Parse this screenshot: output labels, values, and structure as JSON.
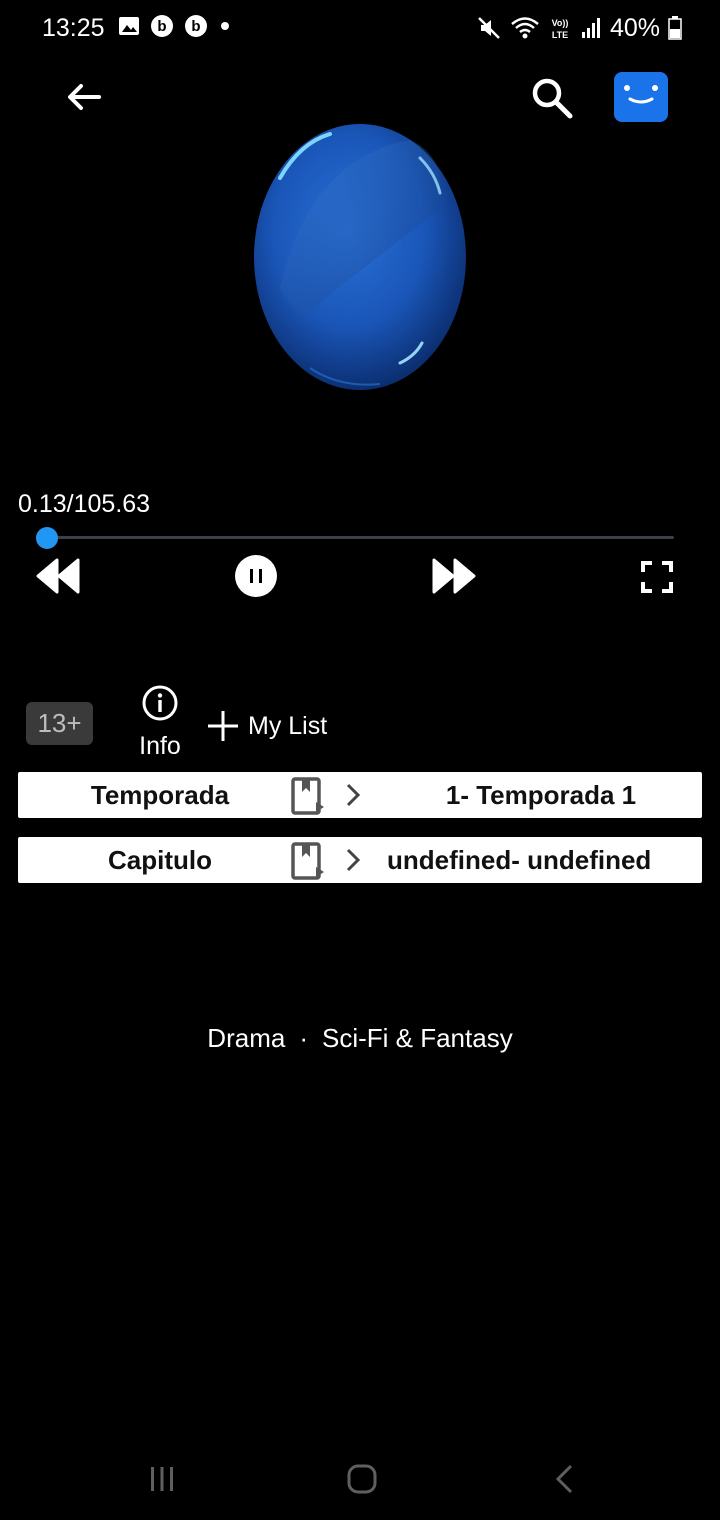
{
  "status_bar": {
    "time": "13:25",
    "battery": "40%",
    "icons": [
      "gallery-icon",
      "b-app-icon",
      "b-app-icon",
      "dot-icon",
      "mute-icon",
      "wifi-icon",
      "volte-icon",
      "signal-icon",
      "battery-icon"
    ]
  },
  "app_bar": {
    "back_icon": "arrow-left-icon",
    "search_icon": "search-icon",
    "avatar_icon": "smiley-avatar-icon"
  },
  "player": {
    "time_display": "0.13/105.63",
    "progress_fraction": 0.0012,
    "accent_color": "#2196f3"
  },
  "meta": {
    "rating": "13+",
    "info_label": "Info",
    "mylist_label": "My List"
  },
  "selectors": {
    "season": {
      "label": "Temporada",
      "value": "1-  Temporada 1"
    },
    "episode": {
      "label": "Capitulo",
      "value": "undefined-  undefined"
    }
  },
  "genres": {
    "first": "Drama",
    "separator": "·",
    "second": "Sci-Fi & Fantasy"
  }
}
